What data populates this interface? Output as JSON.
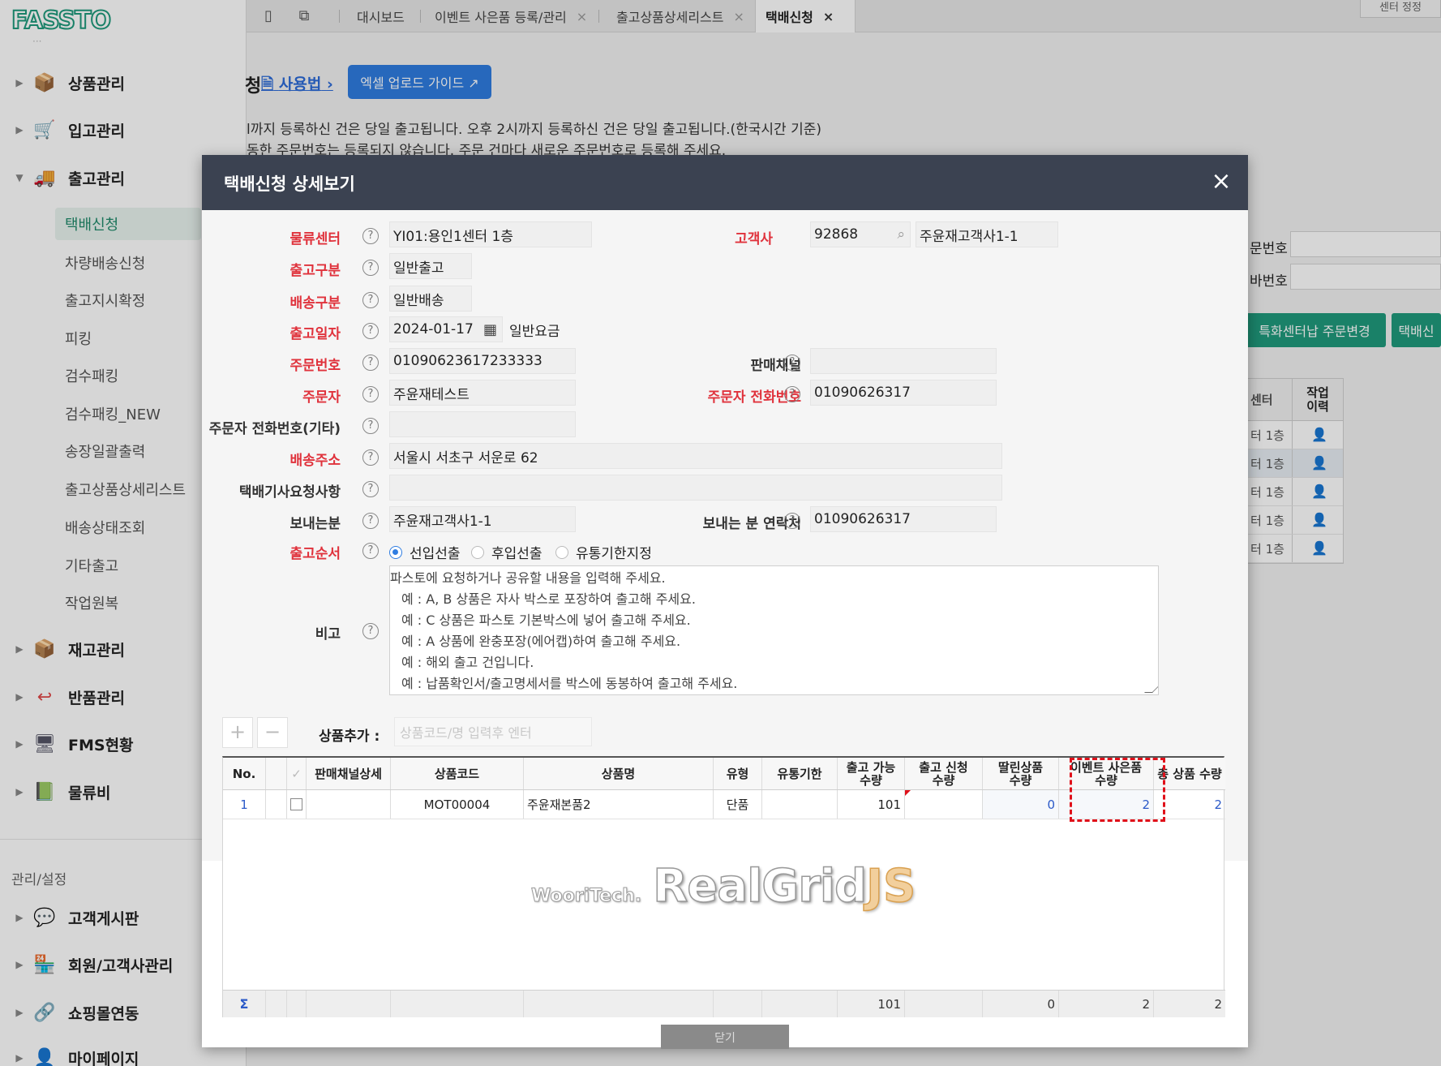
{
  "sidebar": {
    "logo": "FASSTO",
    "logo_dots": "···",
    "menus": [
      {
        "label": "상품관리"
      },
      {
        "label": "입고관리"
      },
      {
        "label": "출고관리"
      },
      {
        "label": "재고관리"
      },
      {
        "label": "반품관리"
      },
      {
        "label": "FMS현황"
      },
      {
        "label": "물류비"
      }
    ],
    "submenu": [
      {
        "label": "택배신청"
      },
      {
        "label": "차량배송신청"
      },
      {
        "label": "출고지시확정"
      },
      {
        "label": "피킹"
      },
      {
        "label": "검수패킹"
      },
      {
        "label": "검수패킹_NEW"
      },
      {
        "label": "송장일괄출력"
      },
      {
        "label": "출고상품상세리스트"
      },
      {
        "label": "배송상태조회"
      },
      {
        "label": "기타출고"
      },
      {
        "label": "작업원복"
      }
    ],
    "settings_label": "관리/설정",
    "settings_menus": [
      {
        "label": "고객게시판"
      },
      {
        "label": "회원/고객사관리"
      },
      {
        "label": "쇼핑몰연동"
      },
      {
        "label": "마이페이지"
      }
    ]
  },
  "tabs": [
    {
      "label": "대시보드"
    },
    {
      "label": "이벤트 사은품 등록/관리"
    },
    {
      "label": "출고상품상세리스트"
    },
    {
      "label": "택배신청"
    }
  ],
  "top_right_label": "센터 정정",
  "background_page": {
    "title_fragment": "청",
    "usage_link": "사용법",
    "excel_guide_btn": "엑셀 업로드 가이드 ↗",
    "notice1": "l까지 등록하신 건은 당일 출고됩니다. 오후 2시까지 등록하신 건은 당일 출고됩니다.(한국시간 기준)",
    "notice2": "동한 주문번호는 등록되지 않습니다. 주문 건마다 새로운 주문번호로 등록해 주세요.",
    "field1_label": "문번호",
    "field2_label": "바번호",
    "btn_change_order": "특화센터납 주문변경",
    "btn_delivery": "택배신",
    "table_head_center": "센터",
    "table_head_log": "작업\n이력",
    "table_rows": [
      "터 1층",
      "터 1층",
      "터 1층",
      "터 1층",
      "터 1층"
    ]
  },
  "modal": {
    "title": "택배신청 상세보기",
    "close_icon": "×",
    "fields": {
      "center_label": "물류센터",
      "center_value": "YI01:용인1센터 1층",
      "customer_label": "고객사",
      "customer_code": "92868",
      "customer_name": "주윤재고객사1-1",
      "out_type_label": "출고구분",
      "out_type_value": "일반출고",
      "ship_type_label": "배송구분",
      "ship_type_value": "일반배송",
      "out_date_label": "출고일자",
      "out_date_value": "2024-01-17",
      "rate_text": "일반요금",
      "order_no_label": "주문번호",
      "order_no_value": "01090623617233333",
      "channel_label": "판매채널",
      "channel_value": "",
      "orderer_label": "주문자",
      "orderer_value": "주윤재테스트",
      "orderer_phone_label": "주문자 전화번호",
      "orderer_phone_value": "01090626317",
      "orderer_phone_etc_label": "주문자 전화번호(기타)",
      "orderer_phone_etc_value": "",
      "address_label": "배송주소",
      "address_value": "서울시 서초구 서운로 62",
      "driver_req_label": "택배기사요청사항",
      "driver_req_value": "",
      "sender_label": "보내는분",
      "sender_value": "주윤재고객사1-1",
      "sender_phone_label": "보내는 분 연락처",
      "sender_phone_value": "01090626317",
      "out_order_label": "출고순서",
      "out_order_options": [
        "선입선출",
        "후입선출",
        "유통기한지정"
      ],
      "out_order_selected": "선입선출",
      "memo_label": "비고",
      "memo_lines": [
        "파스토에 요청하거나 공유할 내용을 입력해 주세요.",
        "예 : A, B 상품은 자사 박스로 포장하여 출고해 주세요.",
        "예 : C 상품은 파스토 기본박스에 넣어 출고해 주세요.",
        "예 : A 상품에 완충포장(에어캡)하여 출고해 주세요.",
        "예 : 해외 출고 건입니다.",
        "예 : 납품확인서/출고명세서를 박스에 동봉하여 출고해 주세요."
      ]
    },
    "product_add": {
      "plus": "+",
      "minus": "−",
      "label": "상품추가 :",
      "placeholder": "상품코드/명 입력후 엔터"
    },
    "grid": {
      "headers": {
        "no": "No.",
        "check": "✓",
        "channel_detail": "판매채널상세",
        "code": "상품코드",
        "name": "상품명",
        "type": "유형",
        "expiry": "유통기한",
        "available": "출고 가능\n수량",
        "request": "출고 신청\n수량",
        "attached": "딸린상품\n수량",
        "event_gift": "이벤트 사은품\n수량",
        "total": "총 상품 수량"
      },
      "rows": [
        {
          "no": "1",
          "channel_detail": "",
          "code": "MOT00004",
          "name": "주윤재본품2",
          "type": "단품",
          "expiry": "",
          "available": "101",
          "request": "",
          "attached": "0",
          "event_gift": "2",
          "total": "2"
        }
      ],
      "footer": {
        "sigma": "Σ",
        "available": "101",
        "attached": "0",
        "event_gift": "2",
        "total": "2"
      },
      "watermark_brand": "WooriTech.",
      "watermark_main": "RealGrid",
      "watermark_js": "JS"
    },
    "bottom_button": "닫기"
  },
  "colors": {
    "brand_green": "#1f9a7c",
    "primary_blue": "#2f7de1",
    "modal_header": "#3b4251",
    "required_red": "#e0323c",
    "highlight_red": "#e0101a"
  }
}
